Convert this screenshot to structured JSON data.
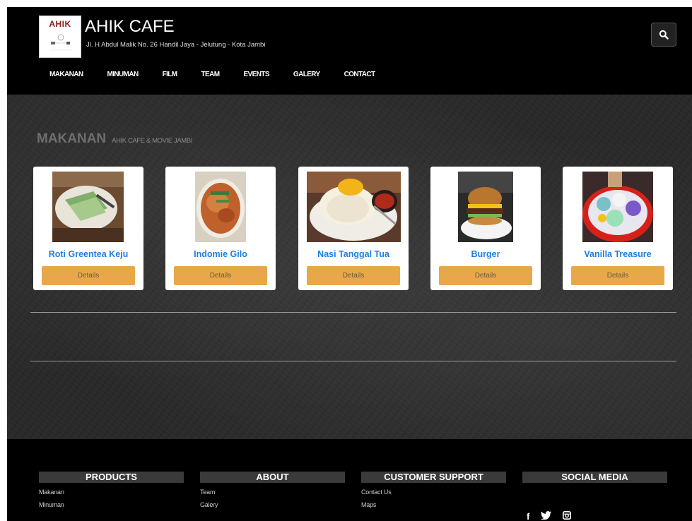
{
  "header": {
    "logo_text": "AHIK",
    "site_title": "AHIK CAFE",
    "address": "Jl. H Abdul Malik No. 26 Handil Jaya - Jelutung - Kota Jambi",
    "search_icon": "search-icon"
  },
  "nav": {
    "items": [
      {
        "label": "MAKANAN"
      },
      {
        "label": "MINUMAN"
      },
      {
        "label": "FILM"
      },
      {
        "label": "TEAM"
      },
      {
        "label": "EVENTS"
      },
      {
        "label": "GALERY"
      },
      {
        "label": "CONTACT"
      }
    ]
  },
  "section": {
    "title": "MAKANAN",
    "subtitle": "AHIK CAFE & MOVIE JAMBI"
  },
  "products": [
    {
      "name": "Roti Greentea Keju",
      "button": "Details",
      "image": "green tea toast"
    },
    {
      "name": "Indomie Gilo",
      "button": "Details",
      "image": "fried noodles"
    },
    {
      "name": "Nasi Tanggal Tua",
      "button": "Details",
      "image": "fried egg rice"
    },
    {
      "name": "Burger",
      "button": "Details",
      "image": "burger"
    },
    {
      "name": "Vanilla Treasure",
      "button": "Details",
      "image": "ice dessert"
    }
  ],
  "footer": {
    "columns": [
      {
        "heading": "PRODUCTS",
        "links": [
          "Makanan",
          "Minuman"
        ]
      },
      {
        "heading": "ABOUT",
        "links": [
          "Team",
          "Galery"
        ]
      },
      {
        "heading": "CUSTOMER SUPPORT",
        "links": [
          "Contact Us",
          "Maps"
        ]
      },
      {
        "heading": "SOCIAL MEDIA",
        "links": []
      }
    ],
    "social": [
      {
        "icon": "facebook-icon",
        "glyph": "f"
      },
      {
        "icon": "twitter-icon",
        "glyph": "🐦"
      },
      {
        "icon": "instagram-icon",
        "glyph": "◙"
      }
    ]
  },
  "colors": {
    "accent_button": "#e8a84a",
    "product_name": "#1e7ee0",
    "background": "#000000"
  }
}
